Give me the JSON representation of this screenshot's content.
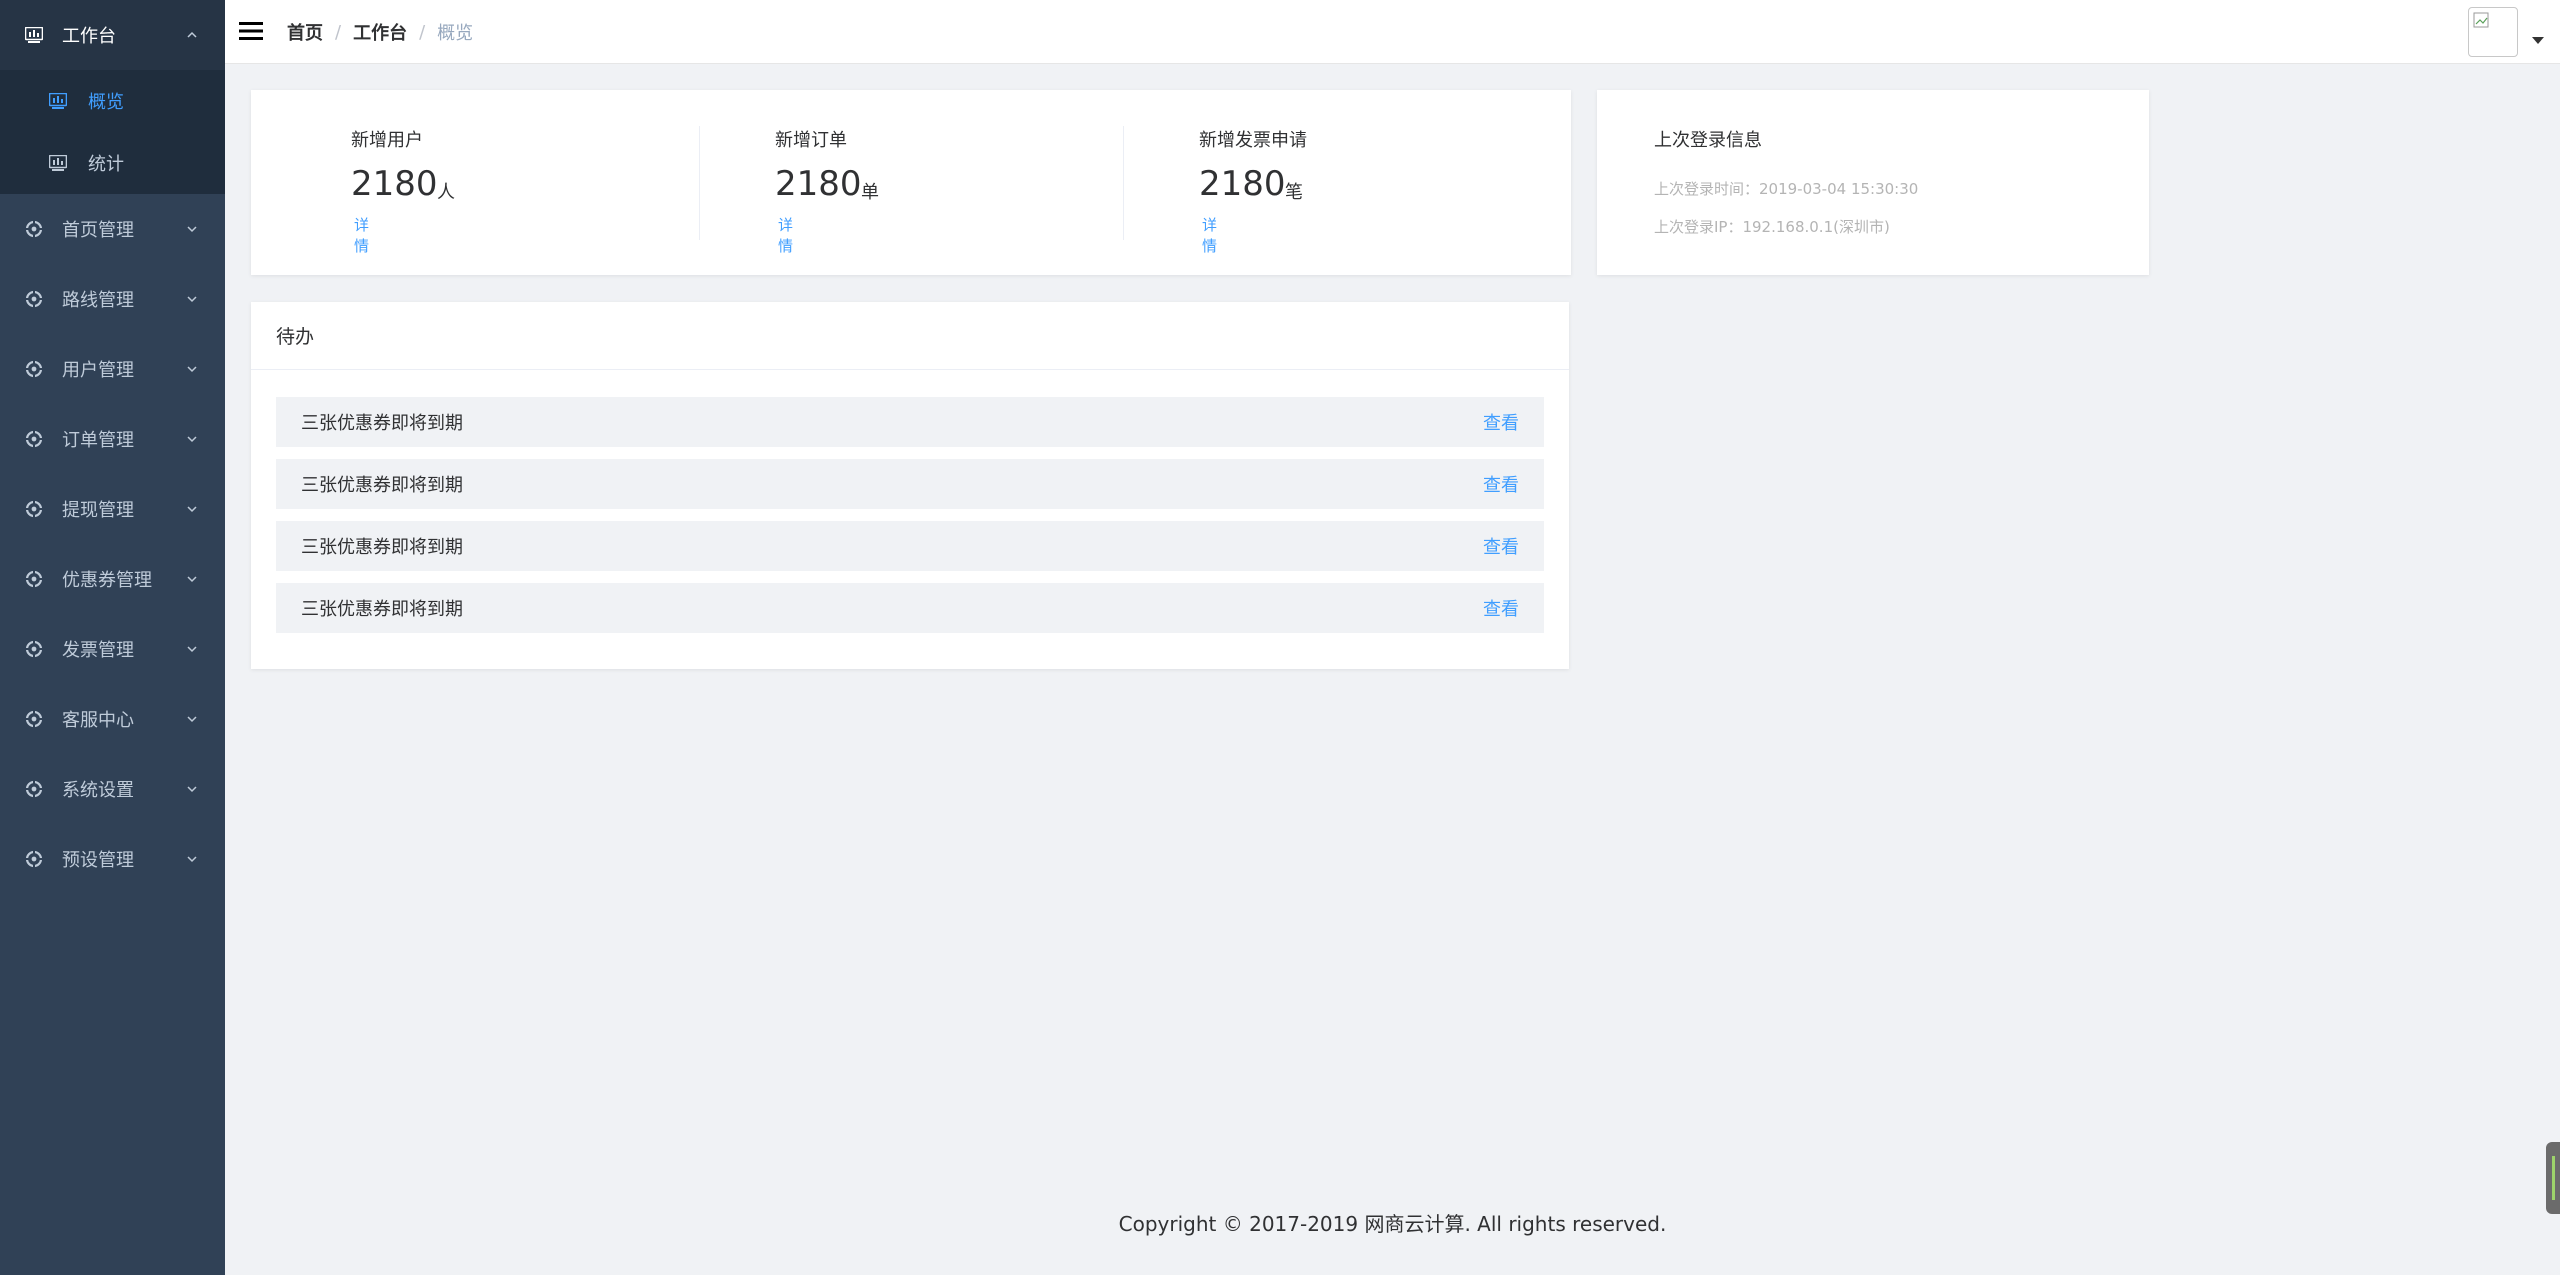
{
  "sidebar": {
    "workbench": {
      "label": "工作台",
      "children": [
        {
          "label": "概览"
        },
        {
          "label": "统计"
        }
      ]
    },
    "items": [
      {
        "label": "首页管理"
      },
      {
        "label": "路线管理"
      },
      {
        "label": "用户管理"
      },
      {
        "label": "订单管理"
      },
      {
        "label": "提现管理"
      },
      {
        "label": "优惠券管理"
      },
      {
        "label": "发票管理"
      },
      {
        "label": "客服中心"
      },
      {
        "label": "系统设置"
      },
      {
        "label": "预设管理"
      }
    ]
  },
  "header": {
    "breadcrumb": [
      "首页",
      "工作台",
      "概览"
    ],
    "separator": "/"
  },
  "stats": [
    {
      "label": "新增用户",
      "value": "2180",
      "unit": "人",
      "link": "详情"
    },
    {
      "label": "新增订单",
      "value": "2180",
      "unit": "单",
      "link": "详情"
    },
    {
      "label": "新增发票申请",
      "value": "2180",
      "unit": "笔",
      "link": "详情"
    }
  ],
  "login_info": {
    "title": "上次登录信息",
    "time": "上次登录时间：2019-03-04 15:30:30",
    "ip": "上次登录IP：192.168.0.1(深圳市)"
  },
  "todo": {
    "title": "待办",
    "items": [
      {
        "text": "三张优惠券即将到期",
        "action": "查看"
      },
      {
        "text": "三张优惠券即将到期",
        "action": "查看"
      },
      {
        "text": "三张优惠券即将到期",
        "action": "查看"
      },
      {
        "text": "三张优惠券即将到期",
        "action": "查看"
      }
    ]
  },
  "footer": {
    "copyright": "Copyright © 2017-2019 网商云计算. All rights reserved."
  },
  "colors": {
    "sidebar_bg": "#304156",
    "submenu_bg": "#1f2d3d",
    "accent": "#409eff",
    "page_bg": "#f0f2f5"
  }
}
